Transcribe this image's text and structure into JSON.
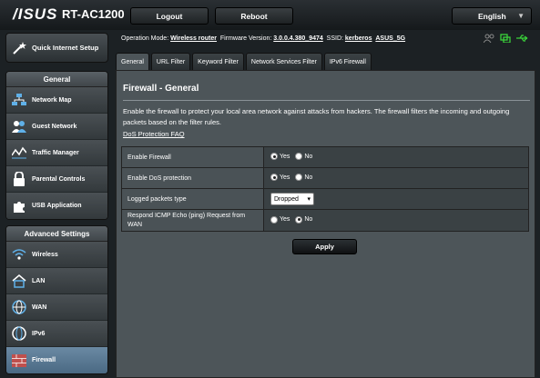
{
  "header": {
    "brand": "/ISUS",
    "model": "RT-AC1200",
    "logout_label": "Logout",
    "reboot_label": "Reboot",
    "language": "English"
  },
  "sidebar": {
    "quick_setup": "Quick Internet Setup",
    "general_title": "General",
    "general_items": [
      {
        "label": "Network Map",
        "icon": "network-map-icon"
      },
      {
        "label": "Guest Network",
        "icon": "guest-network-icon"
      },
      {
        "label": "Traffic Manager",
        "icon": "traffic-manager-icon"
      },
      {
        "label": "Parental Controls",
        "icon": "parental-controls-icon"
      },
      {
        "label": "USB Application",
        "icon": "usb-application-icon"
      }
    ],
    "advanced_title": "Advanced Settings",
    "advanced_items": [
      {
        "label": "Wireless",
        "icon": "wireless-icon"
      },
      {
        "label": "LAN",
        "icon": "lan-icon"
      },
      {
        "label": "WAN",
        "icon": "wan-icon"
      },
      {
        "label": "IPv6",
        "icon": "ipv6-icon"
      },
      {
        "label": "Firewall",
        "icon": "firewall-icon",
        "active": true
      }
    ]
  },
  "status": {
    "op_mode_label": "Operation Mode:",
    "op_mode": "Wireless router",
    "fw_label": "Firmware Version:",
    "fw": "3.0.0.4.380_9474",
    "ssid_label": "SSID:",
    "ssid1": "kerberos",
    "ssid2": "ASUS_5G"
  },
  "tabs": [
    "General",
    "URL Filter",
    "Keyword Filter",
    "Network Services Filter",
    "IPv6 Firewall"
  ],
  "page": {
    "title": "Firewall - General",
    "description": "Enable the firewall to protect your local area network against attacks from hackers. The firewall filters the incoming and outgoing packets based on the filter rules.",
    "faq_link": "DoS Protection FAQ",
    "apply_label": "Apply"
  },
  "settings": {
    "enable_firewall": {
      "label": "Enable Firewall",
      "yes": "Yes",
      "no": "No",
      "value": "Yes"
    },
    "enable_dos": {
      "label": "Enable DoS protection",
      "yes": "Yes",
      "no": "No",
      "value": "Yes"
    },
    "logged_packets": {
      "label": "Logged packets type",
      "value": "Dropped"
    },
    "icmp_echo": {
      "label": "Respond ICMP Echo (ping) Request from WAN",
      "yes": "Yes",
      "no": "No",
      "value": "No"
    }
  },
  "colors": {
    "background": "#1c2124",
    "content": "#4d5559",
    "active_nav": "#6a89a3",
    "status_green": "#3ad13a"
  }
}
